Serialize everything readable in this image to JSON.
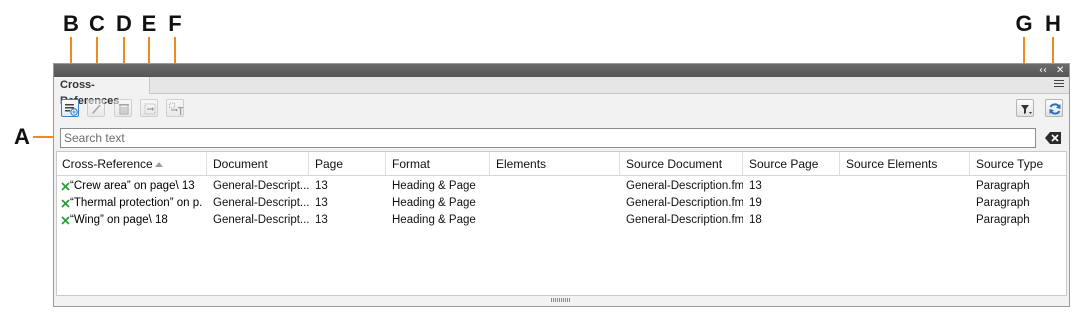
{
  "callouts": {
    "a": "A",
    "b": "B",
    "c": "C",
    "d": "D",
    "e": "E",
    "f": "F",
    "g": "G",
    "h": "H"
  },
  "panel": {
    "title": "Cross-References",
    "collapse_glyph": "‹‹",
    "close_glyph": "✕"
  },
  "toolbar": {
    "icons": [
      "insert-xref-icon",
      "edit-xref-icon",
      "delete-xref-icon",
      "go-to-source-icon",
      "go-to-xref-icon",
      "filter-icon",
      "refresh-icon"
    ]
  },
  "search": {
    "placeholder": "Search text",
    "value": ""
  },
  "table": {
    "columns": [
      "Cross-Reference",
      "Document",
      "Page",
      "Format",
      "Elements",
      "Source Document",
      "Source Page",
      "Source Elements",
      "Source Type"
    ],
    "rows": [
      {
        "xref": "“Crew area” on page\\ 13",
        "document": "General-Descript...",
        "page": "13",
        "format": "Heading & Page",
        "elements": "",
        "source_document": "General-Description.fm",
        "source_page": "13",
        "source_elements": "",
        "source_type": "Paragraph"
      },
      {
        "xref": "“Thermal protection” on p...",
        "document": "General-Descript...",
        "page": "13",
        "format": "Heading & Page",
        "elements": "",
        "source_document": "General-Description.fm",
        "source_page": "19",
        "source_elements": "",
        "source_type": "Paragraph"
      },
      {
        "xref": "“Wing” on page\\ 18",
        "document": "General-Descript...",
        "page": "13",
        "format": "Heading & Page",
        "elements": "",
        "source_document": "General-Description.fm",
        "source_page": "18",
        "source_elements": "",
        "source_type": "Paragraph"
      }
    ]
  },
  "colors": {
    "callout_line": "#f08a1c",
    "accent": "#3a7fc8",
    "status_ok": "#2e9b3e"
  }
}
